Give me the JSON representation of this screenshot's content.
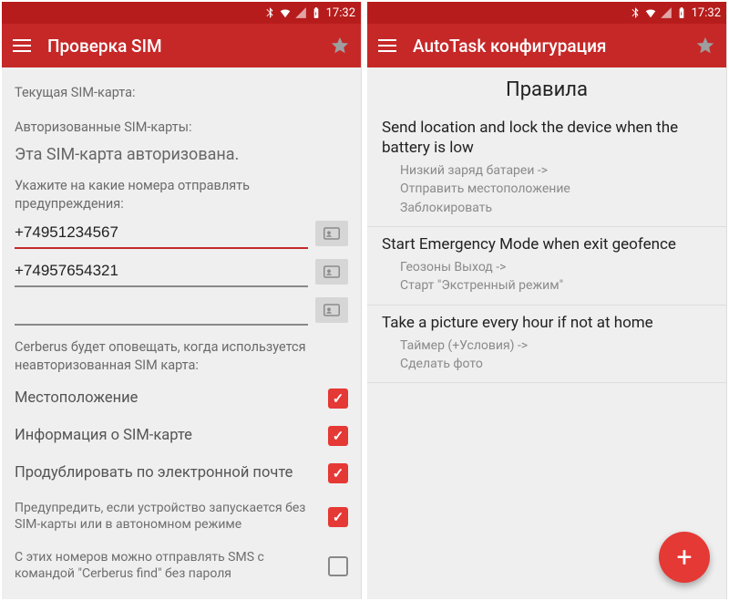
{
  "statusbar": {
    "time": "17:32"
  },
  "left": {
    "title": "Проверка SIM",
    "current_sim_label": "Текущая SIM-карта:",
    "authorized_label": "Авторизованные SIM-карты:",
    "authorized_status": "Эта SIM-карта авторизована.",
    "send_alerts_label": "Укажите на какие номера отправлять предупреждения:",
    "phones": [
      "+74951234567",
      "+74957654321",
      ""
    ],
    "notice": "Cerberus будет оповещать, когда используется неавторизованная SIM карта:",
    "checks": [
      {
        "label": "Местоположение",
        "checked": true,
        "small": false
      },
      {
        "label": "Информация о SIM-карте",
        "checked": true,
        "small": false
      },
      {
        "label": "Продублировать по электронной почте",
        "checked": true,
        "small": false
      },
      {
        "label": "Предупредить, если устройство запускается без SIM-карты или в автономном режиме",
        "checked": true,
        "small": true
      },
      {
        "label": "С этих номеров можно отправлять SMS с командой \"Cerberus find\" без пароля",
        "checked": false,
        "small": true
      }
    ]
  },
  "right": {
    "title": "AutoTask конфигурация",
    "heading": "Правила",
    "rules": [
      {
        "title": "Send location and lock the device when the battery is low",
        "detail": "Низкий заряд батареи ->\n  Отправить местоположение\n  Заблокировать"
      },
      {
        "title": "Start Emergency Mode when exit geofence",
        "detail": "Геозоны Выход ->\n  Старт \"Экстренный режим\""
      },
      {
        "title": "Take a picture every hour if not at home",
        "detail": "Таймер (+Условия) ->\n  Сделать фото"
      }
    ],
    "fab": "+"
  }
}
